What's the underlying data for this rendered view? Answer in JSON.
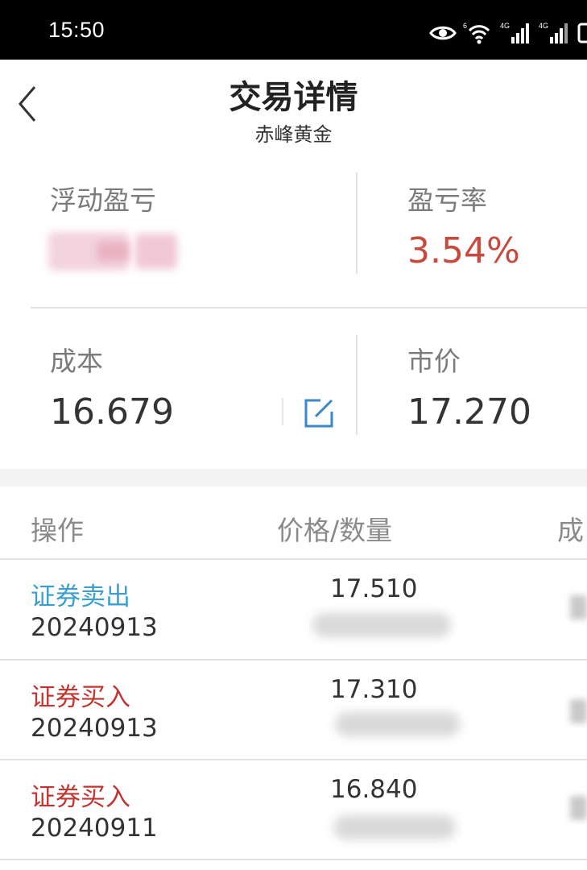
{
  "status_bar": {
    "time": "15:50",
    "network_1": "6",
    "network_2": "4G",
    "network_3": "4G"
  },
  "header": {
    "title": "交易详情",
    "subtitle": "赤峰黄金"
  },
  "summary": {
    "floating_pnl_label": "浮动盈亏",
    "pnl_rate_label": "盈亏率",
    "pnl_rate_value": "3.54%",
    "cost_label": "成本",
    "cost_value": "16.679",
    "market_price_label": "市价",
    "market_price_value": "17.270"
  },
  "table": {
    "headers": [
      "操作",
      "价格/数量",
      "成"
    ],
    "rows": [
      {
        "action": "证券卖出",
        "date": "20240913",
        "price": "17.510",
        "type": "sell"
      },
      {
        "action": "证券买入",
        "date": "20240913",
        "price": "17.310",
        "type": "buy"
      },
      {
        "action": "证券买入",
        "date": "20240911",
        "price": "16.840",
        "type": "buy"
      }
    ]
  },
  "colors": {
    "sell": "#3a9fd0",
    "buy": "#c23531",
    "profit": "#c84a3f"
  }
}
